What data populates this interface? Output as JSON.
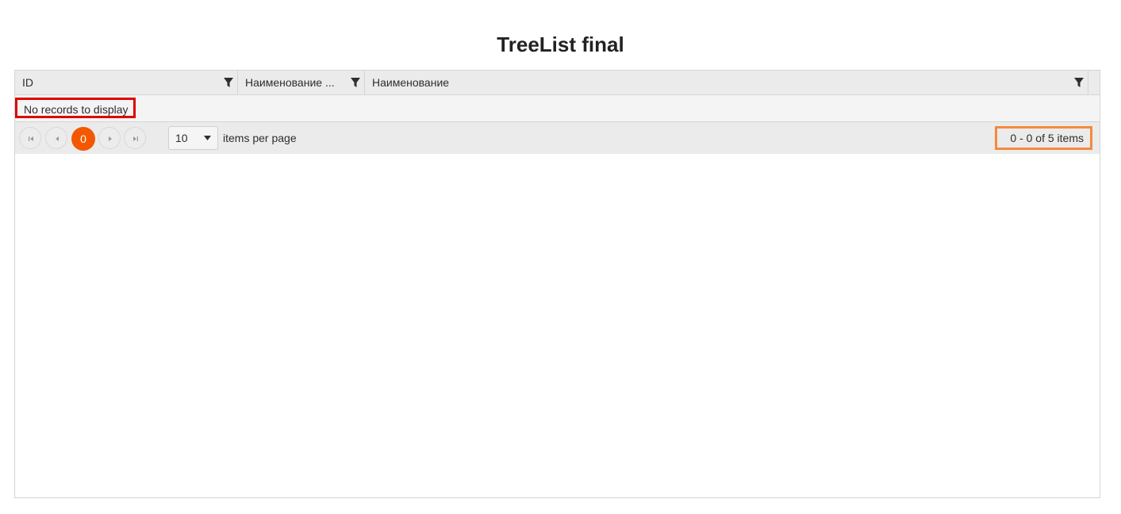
{
  "page": {
    "title": "TreeList final"
  },
  "treelist": {
    "columns": [
      {
        "label": "ID",
        "filterable": true
      },
      {
        "label": "Наименование ...",
        "filterable": true
      },
      {
        "label": "Наименование",
        "filterable": true
      }
    ],
    "no_records_text": "No records to display",
    "pager": {
      "current_page": "0",
      "page_size": "10",
      "items_per_page_label": "items per page",
      "info": "0 - 0 of 5 items"
    }
  },
  "icons": {
    "filter": "filter-icon",
    "first": "seek-first-icon",
    "prev": "arrow-left-icon",
    "next": "arrow-right-icon",
    "last": "seek-last-icon",
    "dropdown": "caret-down-icon"
  },
  "colors": {
    "accent": "#f35800",
    "highlight_red": "#e00000",
    "highlight_orange": "#f58a3c",
    "header_bg": "#ebebeb",
    "row_bg": "#f4f4f4"
  }
}
